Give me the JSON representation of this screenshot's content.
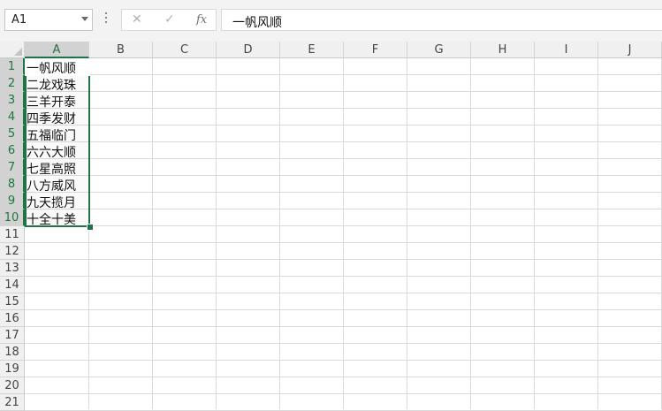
{
  "name_box": {
    "value": "A1"
  },
  "formula_bar": {
    "cancel_icon": "cancel-icon",
    "enter_icon": "enter-icon",
    "fx_label": "fx",
    "value": "一帆风顺"
  },
  "columns": [
    "A",
    "B",
    "C",
    "D",
    "E",
    "F",
    "G",
    "H",
    "I",
    "J"
  ],
  "rows": [
    "1",
    "2",
    "3",
    "4",
    "5",
    "6",
    "7",
    "8",
    "9",
    "10",
    "11",
    "12",
    "13",
    "14",
    "15",
    "16",
    "17",
    "18",
    "19",
    "20",
    "21"
  ],
  "cells_A": [
    "一帆风顺",
    "二龙戏珠",
    "三羊开泰",
    "四季发财",
    "五福临门",
    "六六大顺",
    "七星高照",
    "八方威风",
    "九天揽月",
    "十全十美"
  ],
  "colors": {
    "accent": "#217346",
    "header_bg": "#f0f0f0",
    "selected_header_bg": "#d2d2d2"
  }
}
